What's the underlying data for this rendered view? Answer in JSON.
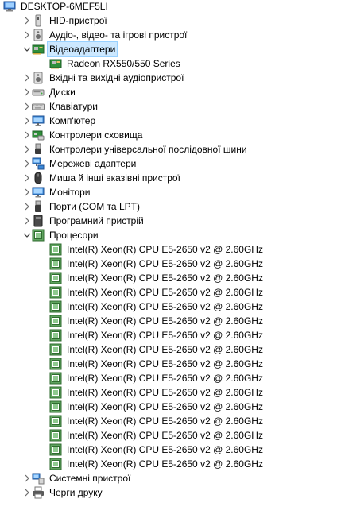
{
  "root": {
    "label": "DESKTOP-6MEF5LI",
    "icon": "computer-icon"
  },
  "categories": [
    {
      "label": "HID-пристрої",
      "icon": "hid-icon",
      "expanded": false
    },
    {
      "label": "Аудіо-, відео- та ігрові пристрої",
      "icon": "speaker-icon",
      "expanded": false
    },
    {
      "label": "Відеоадаптери",
      "icon": "display-adapter-icon",
      "expanded": true,
      "selected": true,
      "children": [
        {
          "label": "Radeon RX550/550 Series",
          "icon": "display-adapter-icon"
        }
      ]
    },
    {
      "label": "Вхідні та вихідні аудіопристрої",
      "icon": "speaker-icon",
      "expanded": false
    },
    {
      "label": "Диски",
      "icon": "disk-drive-icon",
      "expanded": false
    },
    {
      "label": "Клавіатури",
      "icon": "keyboard-icon",
      "expanded": false
    },
    {
      "label": "Комп'ютер",
      "icon": "monitor-icon",
      "expanded": false
    },
    {
      "label": "Контролери сховища",
      "icon": "storage-controller-icon",
      "expanded": false
    },
    {
      "label": "Контролери універсальної послідовної шини",
      "icon": "usb-icon",
      "expanded": false
    },
    {
      "label": "Мережеві адаптери",
      "icon": "network-adapter-icon",
      "expanded": false
    },
    {
      "label": "Миша й інші вказівні пристрої",
      "icon": "mouse-icon",
      "expanded": false
    },
    {
      "label": "Монітори",
      "icon": "monitor-icon",
      "expanded": false
    },
    {
      "label": "Порти (COM та LPT)",
      "icon": "port-icon",
      "expanded": false
    },
    {
      "label": "Програмний пристрій",
      "icon": "software-device-icon",
      "expanded": false
    },
    {
      "label": "Процесори",
      "icon": "processor-icon",
      "expanded": true,
      "children": [
        {
          "label": "Intel(R) Xeon(R) CPU E5-2650 v2 @ 2.60GHz",
          "icon": "processor-icon"
        },
        {
          "label": "Intel(R) Xeon(R) CPU E5-2650 v2 @ 2.60GHz",
          "icon": "processor-icon"
        },
        {
          "label": "Intel(R) Xeon(R) CPU E5-2650 v2 @ 2.60GHz",
          "icon": "processor-icon"
        },
        {
          "label": "Intel(R) Xeon(R) CPU E5-2650 v2 @ 2.60GHz",
          "icon": "processor-icon"
        },
        {
          "label": "Intel(R) Xeon(R) CPU E5-2650 v2 @ 2.60GHz",
          "icon": "processor-icon"
        },
        {
          "label": "Intel(R) Xeon(R) CPU E5-2650 v2 @ 2.60GHz",
          "icon": "processor-icon"
        },
        {
          "label": "Intel(R) Xeon(R) CPU E5-2650 v2 @ 2.60GHz",
          "icon": "processor-icon"
        },
        {
          "label": "Intel(R) Xeon(R) CPU E5-2650 v2 @ 2.60GHz",
          "icon": "processor-icon"
        },
        {
          "label": "Intel(R) Xeon(R) CPU E5-2650 v2 @ 2.60GHz",
          "icon": "processor-icon"
        },
        {
          "label": "Intel(R) Xeon(R) CPU E5-2650 v2 @ 2.60GHz",
          "icon": "processor-icon"
        },
        {
          "label": "Intel(R) Xeon(R) CPU E5-2650 v2 @ 2.60GHz",
          "icon": "processor-icon"
        },
        {
          "label": "Intel(R) Xeon(R) CPU E5-2650 v2 @ 2.60GHz",
          "icon": "processor-icon"
        },
        {
          "label": "Intel(R) Xeon(R) CPU E5-2650 v2 @ 2.60GHz",
          "icon": "processor-icon"
        },
        {
          "label": "Intel(R) Xeon(R) CPU E5-2650 v2 @ 2.60GHz",
          "icon": "processor-icon"
        },
        {
          "label": "Intel(R) Xeon(R) CPU E5-2650 v2 @ 2.60GHz",
          "icon": "processor-icon"
        },
        {
          "label": "Intel(R) Xeon(R) CPU E5-2650 v2 @ 2.60GHz",
          "icon": "processor-icon"
        }
      ]
    },
    {
      "label": "Системні пристрої",
      "icon": "system-device-icon",
      "expanded": false
    },
    {
      "label": "Черги друку",
      "icon": "printer-icon",
      "expanded": false
    }
  ],
  "colors": {
    "selection": "#cce8ff",
    "selection_border": "#99d1ff",
    "chevron": "#6b6b6b"
  }
}
